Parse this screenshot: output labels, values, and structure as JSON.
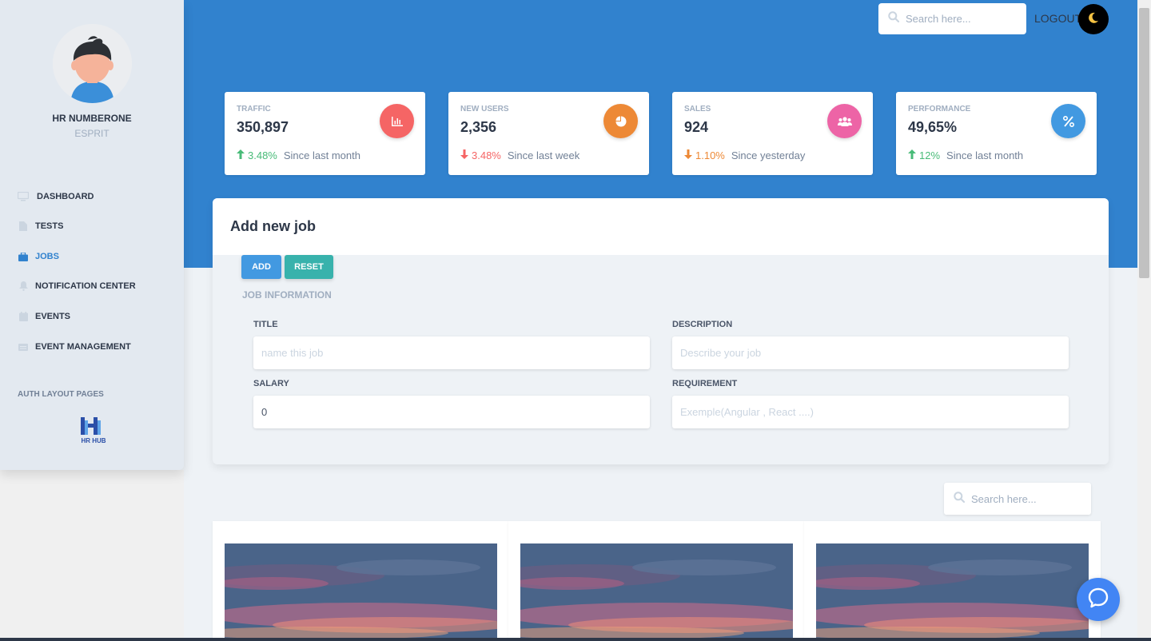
{
  "user": {
    "name": "HR NUMBERONE",
    "org": "ESPRIT"
  },
  "nav": {
    "items": [
      {
        "label": "DASHBOARD",
        "icon": "monitor-icon"
      },
      {
        "label": "TESTS",
        "icon": "file-icon"
      },
      {
        "label": "JOBS",
        "icon": "briefcase-icon",
        "active": true
      },
      {
        "label": "NOTIFICATION CENTER",
        "icon": "bell-icon"
      },
      {
        "label": "EVENTS",
        "icon": "calendar-icon"
      },
      {
        "label": "EVENT MANAGEMENT",
        "icon": "list-icon"
      }
    ],
    "section_label": "AUTH LAYOUT PAGES"
  },
  "logo_text": "HR HUB",
  "header": {
    "search_placeholder": "Search here...",
    "logout_label": "LOGOUT"
  },
  "stats": [
    {
      "label": "TRAFFIC",
      "value": "350,897",
      "change": "3.48%",
      "direction": "up",
      "since": "Since last month",
      "icon": "bar-chart-icon",
      "icon_color": "#f56565",
      "change_color": "#48bb78"
    },
    {
      "label": "NEW USERS",
      "value": "2,356",
      "change": "3.48%",
      "direction": "down",
      "since": "Since last week",
      "icon": "pie-chart-icon",
      "icon_color": "#ed8936",
      "change_color": "#f56565"
    },
    {
      "label": "SALES",
      "value": "924",
      "change": "1.10%",
      "direction": "down",
      "since": "Since yesterday",
      "icon": "users-icon",
      "icon_color": "#ed64a6",
      "change_color": "#ed8936"
    },
    {
      "label": "PERFORMANCE",
      "value": "49,65%",
      "change": "12%",
      "direction": "up",
      "since": "Since last month",
      "icon": "percent-icon",
      "icon_color": "#4299e1",
      "change_color": "#48bb78"
    }
  ],
  "form": {
    "title": "Add new job",
    "add_label": "ADD",
    "reset_label": "RESET",
    "section_label": "JOB INFORMATION",
    "fields": {
      "title": {
        "label": "TITLE",
        "placeholder": "name this job",
        "value": ""
      },
      "description": {
        "label": "DESCRIPTION",
        "placeholder": "Describe your job",
        "value": ""
      },
      "salary": {
        "label": "SALARY",
        "placeholder": "",
        "value": "0"
      },
      "requirement": {
        "label": "REQUIREMENT",
        "placeholder": "Exemple(Angular , React ....)",
        "value": ""
      }
    }
  },
  "list_search_placeholder": "Search here...",
  "colors": {
    "brand": "#3182ce",
    "add": "#4299e1",
    "reset": "#38b2ac"
  }
}
